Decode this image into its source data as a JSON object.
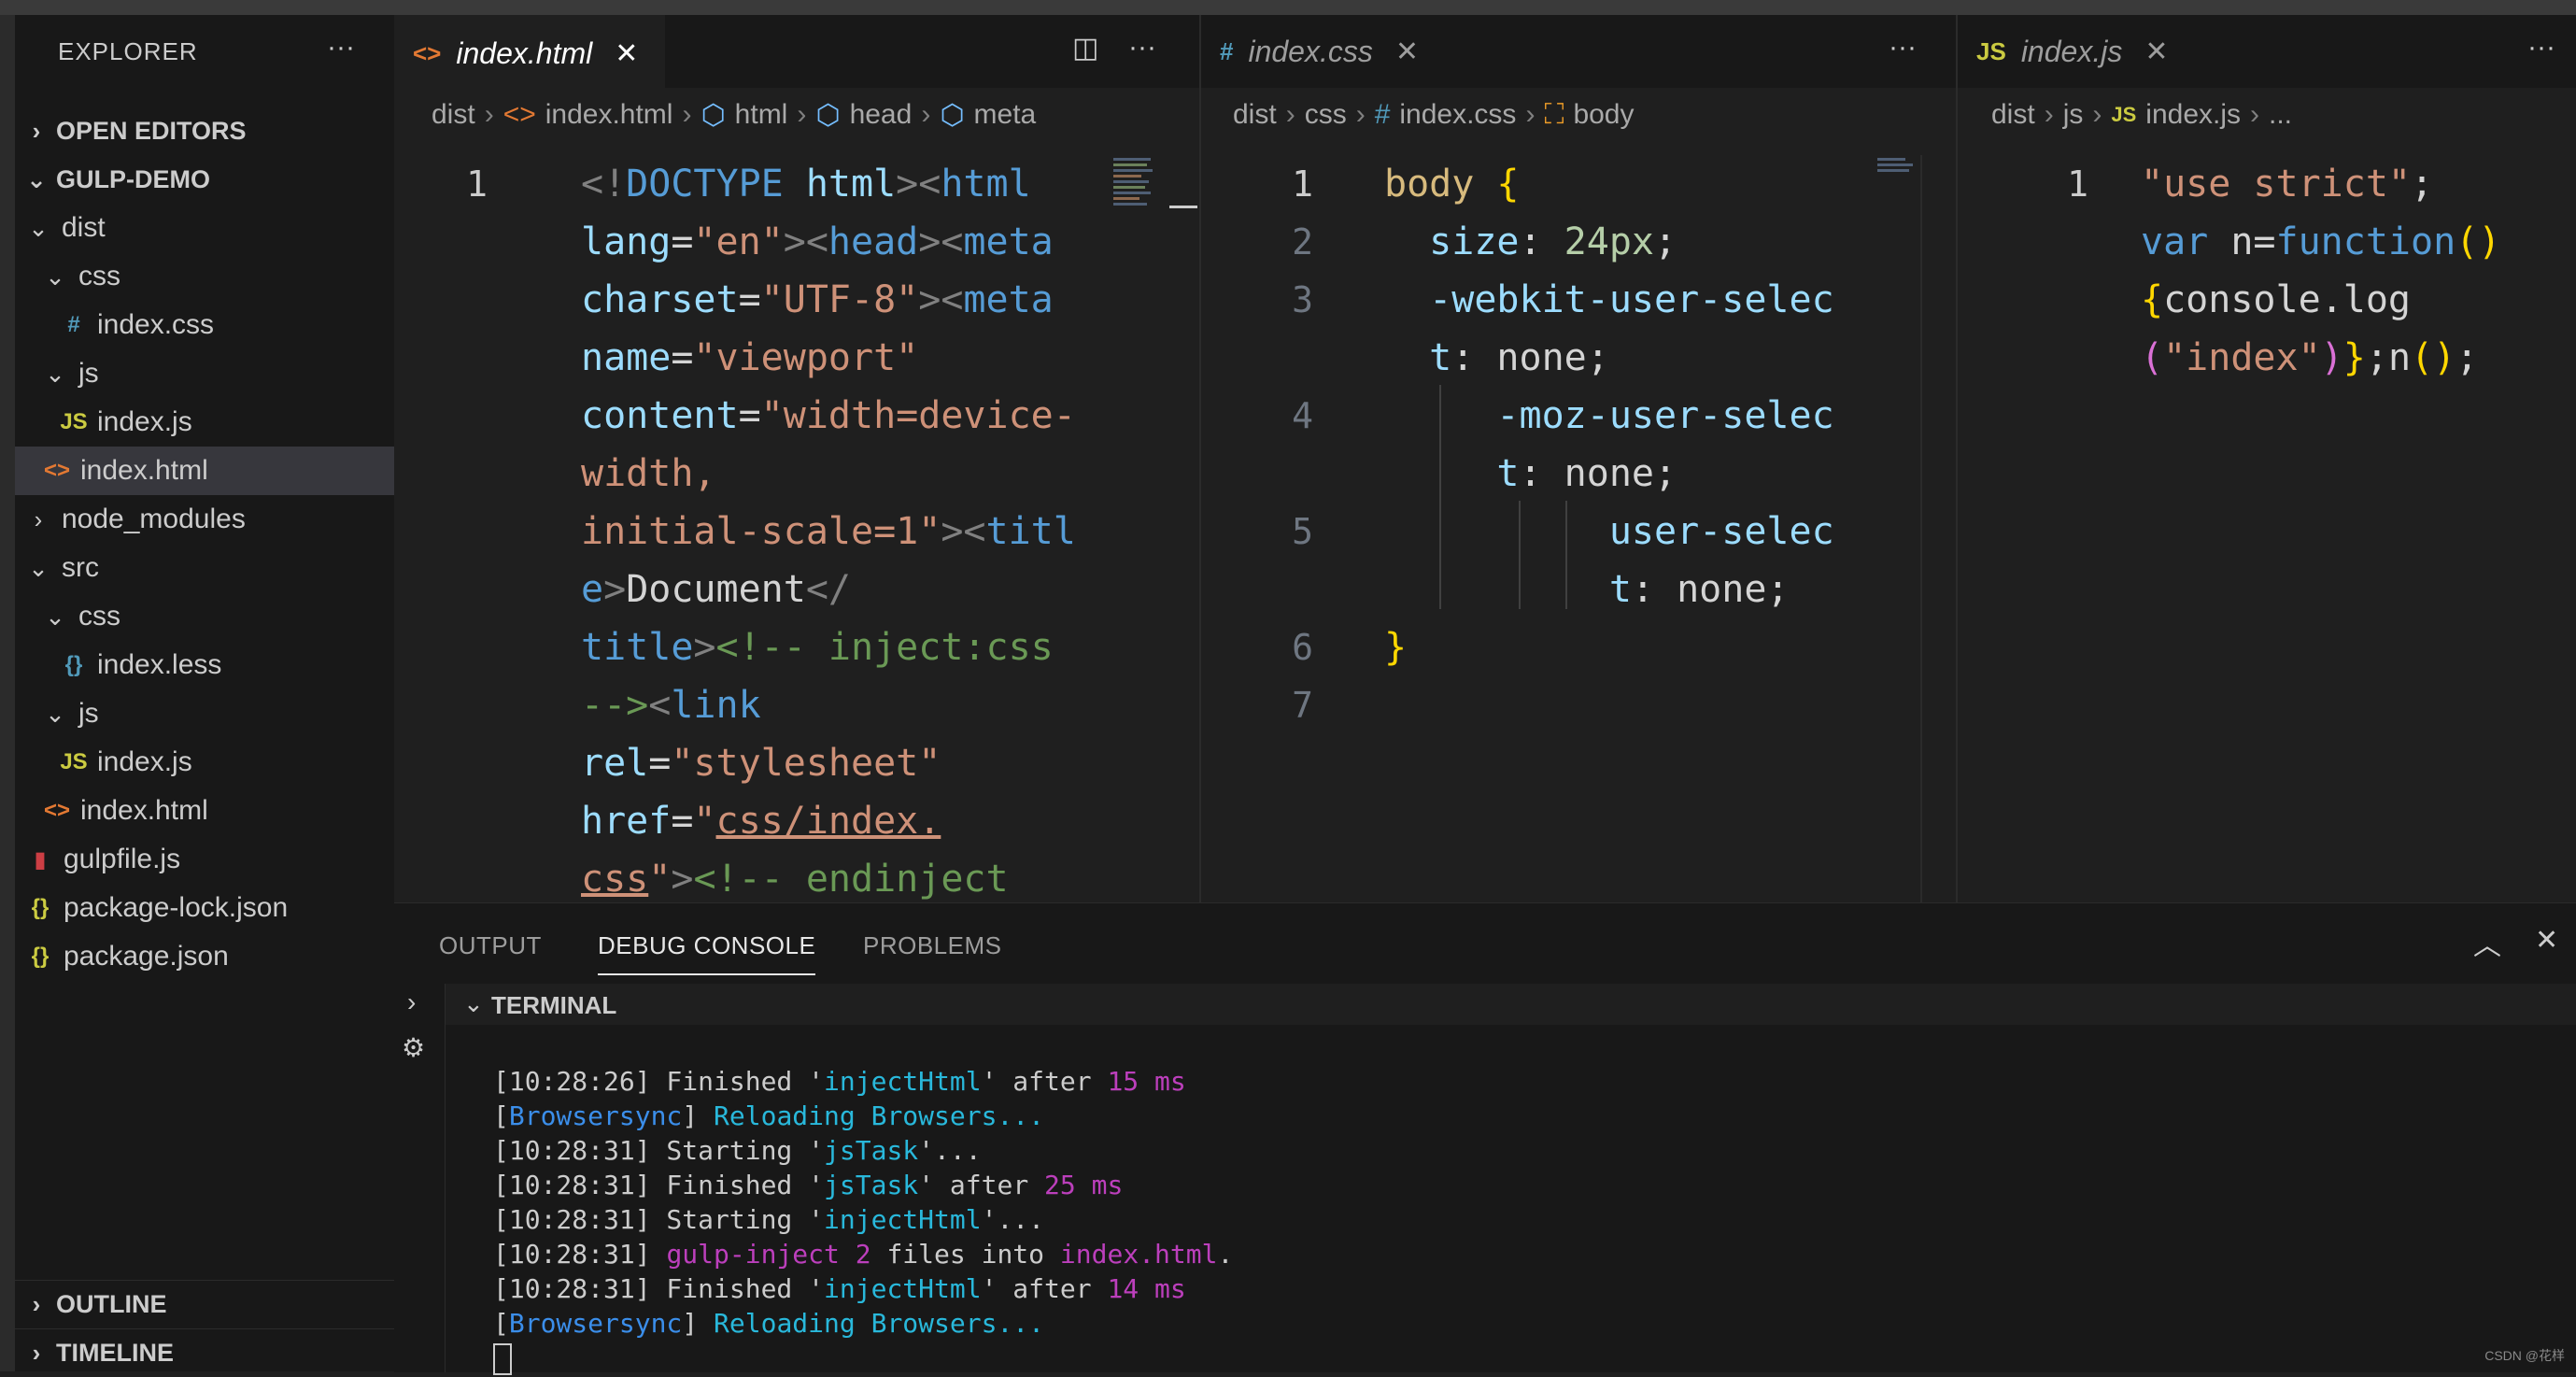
{
  "explorer": {
    "title": "EXPLORER",
    "more": "···",
    "open_editors": "OPEN EDITORS",
    "root": "GULP-DEMO",
    "items": [
      {
        "label": "dist",
        "kind": "folder",
        "open": true,
        "depth": 1
      },
      {
        "label": "css",
        "kind": "folder",
        "open": true,
        "depth": 2
      },
      {
        "label": "index.css",
        "kind": "css",
        "depth": 3
      },
      {
        "label": "js",
        "kind": "folder",
        "open": true,
        "depth": 2
      },
      {
        "label": "index.js",
        "kind": "js",
        "depth": 3
      },
      {
        "label": "index.html",
        "kind": "html",
        "depth": 2,
        "selected": true
      },
      {
        "label": "node_modules",
        "kind": "folder",
        "open": false,
        "depth": 1
      },
      {
        "label": "src",
        "kind": "folder",
        "open": true,
        "depth": 1
      },
      {
        "label": "css",
        "kind": "folder",
        "open": true,
        "depth": 2
      },
      {
        "label": "index.less",
        "kind": "less",
        "depth": 3
      },
      {
        "label": "js",
        "kind": "folder",
        "open": true,
        "depth": 2
      },
      {
        "label": "index.js",
        "kind": "js",
        "depth": 3
      },
      {
        "label": "index.html",
        "kind": "html",
        "depth": 2
      },
      {
        "label": "gulpfile.js",
        "kind": "gulp",
        "depth": 1
      },
      {
        "label": "package-lock.json",
        "kind": "json",
        "depth": 1
      },
      {
        "label": "package.json",
        "kind": "json",
        "depth": 1
      }
    ],
    "outline": "OUTLINE",
    "timeline": "TIMELINE"
  },
  "editors": {
    "html": {
      "tab": "index.html",
      "tab_icon": "<>",
      "close": "✕",
      "crumbs": [
        "dist",
        "index.html",
        "html",
        "head",
        "meta"
      ],
      "line_number": "1"
    },
    "css": {
      "tab": "index.css",
      "tab_icon": "#",
      "close": "✕",
      "crumbs": [
        "dist",
        "css",
        "index.css",
        "body"
      ],
      "line_numbers": [
        "1",
        "2",
        "3",
        "4",
        "5",
        "6",
        "7"
      ]
    },
    "js": {
      "tab": "index.js",
      "tab_icon": "JS",
      "close": "✕",
      "crumbs": [
        "dist",
        "js",
        "index.js",
        "..."
      ],
      "line_number": "1"
    }
  },
  "panel": {
    "tabs": [
      "OUTPUT",
      "DEBUG CONSOLE",
      "PROBLEMS"
    ],
    "active_tab": "DEBUG CONSOLE",
    "terminal_title": "TERMINAL"
  },
  "watermark": "CSDN @花样",
  "colors": {
    "background": "#1f1f1f",
    "sidebar": "#181818",
    "selected_row": "#37373d",
    "keyword": "#569cd6",
    "string": "#ce9178",
    "comment": "#6a9955"
  }
}
